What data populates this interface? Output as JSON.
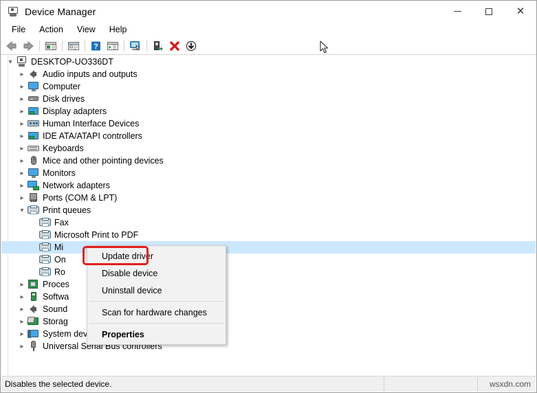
{
  "window": {
    "title": "Device Manager",
    "icon": "device-manager-icon",
    "minimize_label": "—",
    "maximize_label": "",
    "close_label": "✕"
  },
  "menubar": {
    "items": [
      {
        "label": "File"
      },
      {
        "label": "Action"
      },
      {
        "label": "View"
      },
      {
        "label": "Help"
      }
    ]
  },
  "toolbar": {
    "buttons": [
      {
        "name": "back-icon",
        "tooltip": "Back"
      },
      {
        "name": "forward-icon",
        "tooltip": "Forward"
      },
      {
        "name": "show-hide-console-tree-icon",
        "tooltip": "Show/Hide Console Tree"
      },
      {
        "name": "properties-icon",
        "tooltip": "Properties"
      },
      {
        "name": "help-icon",
        "tooltip": "Help"
      },
      {
        "name": "update-driver-toolbar-icon",
        "tooltip": "Update driver"
      },
      {
        "name": "scan-hardware-changes-icon",
        "tooltip": "Scan for hardware changes"
      },
      {
        "name": "enable-device-icon",
        "tooltip": "Enable device"
      },
      {
        "name": "uninstall-device-icon",
        "tooltip": "Uninstall device"
      },
      {
        "name": "disable-device-icon",
        "tooltip": "Disable device"
      }
    ]
  },
  "tree": {
    "root": {
      "label": "DESKTOP-UO336DT",
      "icon": "computer-icon",
      "expanded": true
    },
    "nodes": [
      {
        "label": "Audio inputs and outputs",
        "icon": "speaker-icon",
        "depth": 1,
        "expandable": true,
        "expanded": false
      },
      {
        "label": "Computer",
        "icon": "monitor-icon",
        "depth": 1,
        "expandable": true,
        "expanded": false
      },
      {
        "label": "Disk drives",
        "icon": "disk-icon",
        "depth": 1,
        "expandable": true,
        "expanded": false
      },
      {
        "label": "Display adapters",
        "icon": "display-card-icon",
        "depth": 1,
        "expandable": true,
        "expanded": false
      },
      {
        "label": "Human Interface Devices",
        "icon": "hid-icon",
        "depth": 1,
        "expandable": true,
        "expanded": false
      },
      {
        "label": "IDE ATA/ATAPI controllers",
        "icon": "ide-card-icon",
        "depth": 1,
        "expandable": true,
        "expanded": false
      },
      {
        "label": "Keyboards",
        "icon": "keyboard-icon",
        "depth": 1,
        "expandable": true,
        "expanded": false
      },
      {
        "label": "Mice and other pointing devices",
        "icon": "mouse-icon",
        "depth": 1,
        "expandable": true,
        "expanded": false
      },
      {
        "label": "Monitors",
        "icon": "monitor-icon",
        "depth": 1,
        "expandable": true,
        "expanded": false
      },
      {
        "label": "Network adapters",
        "icon": "network-adapter-icon",
        "depth": 1,
        "expandable": true,
        "expanded": false
      },
      {
        "label": "Ports (COM & LPT)",
        "icon": "port-icon",
        "depth": 1,
        "expandable": true,
        "expanded": false
      },
      {
        "label": "Print queues",
        "icon": "printer-icon",
        "depth": 1,
        "expandable": true,
        "expanded": true
      },
      {
        "label": "Fax",
        "icon": "printer-icon",
        "depth": 2,
        "expandable": false,
        "expanded": false
      },
      {
        "label": "Microsoft Print to PDF",
        "icon": "printer-icon",
        "depth": 2,
        "expandable": false,
        "expanded": false
      },
      {
        "label": "Mi",
        "icon": "printer-icon",
        "depth": 2,
        "expandable": false,
        "expanded": false,
        "selected": true,
        "truncated": true
      },
      {
        "label": "On",
        "icon": "printer-icon",
        "depth": 2,
        "expandable": false,
        "expanded": false,
        "truncated": true
      },
      {
        "label": "Ro",
        "icon": "printer-icon",
        "depth": 2,
        "expandable": false,
        "expanded": false,
        "truncated": true
      },
      {
        "label": "Proces",
        "icon": "processor-icon",
        "depth": 1,
        "expandable": true,
        "expanded": false,
        "truncated": true
      },
      {
        "label": "Softwa",
        "icon": "software-device-icon",
        "depth": 1,
        "expandable": true,
        "expanded": false,
        "truncated": true
      },
      {
        "label": "Sound",
        "icon": "speaker-icon",
        "depth": 1,
        "expandable": true,
        "expanded": false,
        "truncated": true
      },
      {
        "label": "Storag",
        "icon": "storage-icon",
        "depth": 1,
        "expandable": true,
        "expanded": false,
        "truncated": true
      },
      {
        "label": "System devices",
        "icon": "system-device-icon",
        "depth": 1,
        "expandable": true,
        "expanded": false
      },
      {
        "label": "Universal Serial Bus controllers",
        "icon": "usb-icon",
        "depth": 1,
        "expandable": true,
        "expanded": false
      }
    ]
  },
  "context_menu": {
    "items": [
      {
        "label": "Update driver",
        "bold": false,
        "highlighted": true
      },
      {
        "label": "Disable device",
        "bold": false,
        "highlighted": false
      },
      {
        "label": "Uninstall device",
        "bold": false,
        "highlighted": false
      },
      {
        "separator": true
      },
      {
        "label": "Scan for hardware changes",
        "bold": false,
        "highlighted": false
      },
      {
        "separator": true
      },
      {
        "label": "Properties",
        "bold": true,
        "highlighted": false
      }
    ],
    "highlight_color": "#e02020"
  },
  "statusbar": {
    "message": "Disables the selected device.",
    "middle": "",
    "watermark": "wsxdn.com"
  }
}
